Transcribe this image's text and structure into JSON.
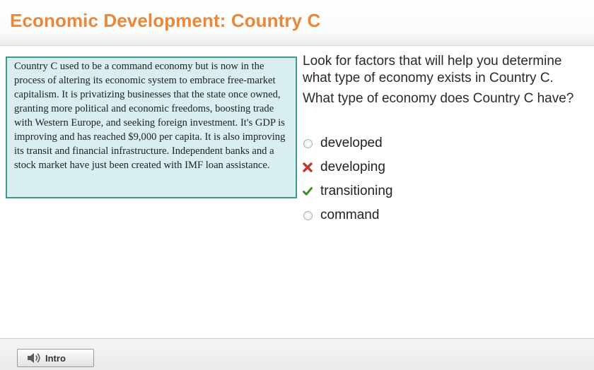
{
  "header": {
    "title": "Economic Development: Country C"
  },
  "passage": {
    "text": "Country C used to be a command economy but is now in the process of altering its economic system to embrace free-market capitalism. It is privatizing businesses that the state once owned, granting more political and economic freedoms, boosting trade with Western Europe, and seeking foreign investment. It's GDP is improving and has reached $9,000 per capita. It is also improving its transit and financial infrastructure. Independent banks and a stock market have just been created with IMF loan assistance."
  },
  "question": {
    "hint": "Look for factors that will help you determine what type of economy exists in Country C.",
    "prompt": "What type of economy does Country C have?",
    "options": [
      {
        "label": "developed",
        "state": "unselected"
      },
      {
        "label": "developing",
        "state": "incorrect"
      },
      {
        "label": "transitioning",
        "state": "correct"
      },
      {
        "label": "command",
        "state": "unselected"
      }
    ]
  },
  "footer": {
    "intro_label": "Intro",
    "intro_icon": "speaker-icon"
  },
  "colors": {
    "title": "#e8883a",
    "passage_border": "#3c9b8a",
    "passage_bg": "#d9eef0",
    "incorrect": "#c0392b",
    "correct": "#3a8f2a"
  }
}
